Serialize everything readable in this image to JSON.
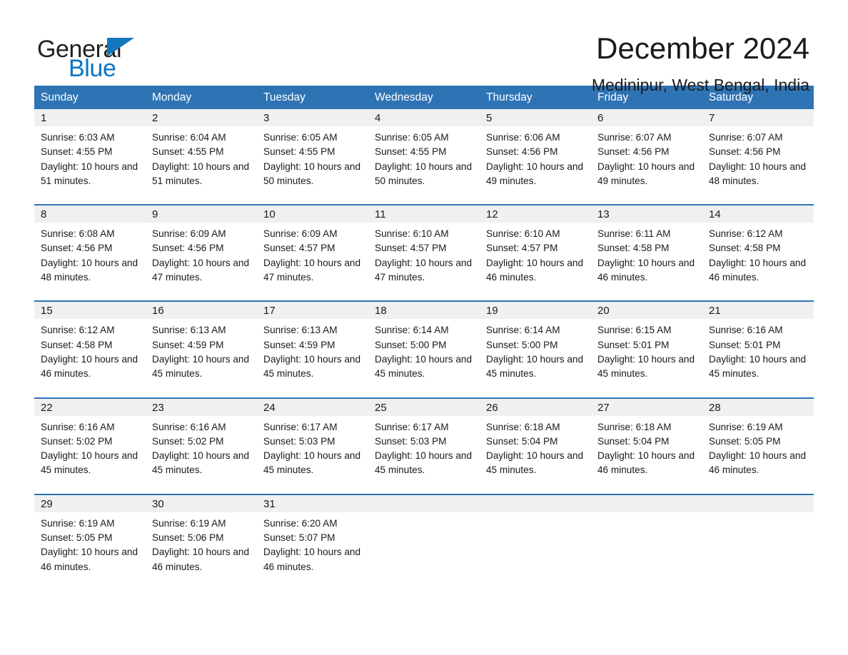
{
  "brand": {
    "word_general": "General",
    "word_blue": "Blue",
    "accent_color": "#2e74b5",
    "triangle_color": "#1277bf"
  },
  "header": {
    "month_title": "December 2024",
    "location": "Medinipur, West Bengal, India"
  },
  "calendar": {
    "weekdays": [
      "Sunday",
      "Monday",
      "Tuesday",
      "Wednesday",
      "Thursday",
      "Friday",
      "Saturday"
    ],
    "weeks": [
      [
        {
          "day": "1",
          "sunrise": "Sunrise: 6:03 AM",
          "sunset": "Sunset: 4:55 PM",
          "daylight": "Daylight: 10 hours and 51 minutes."
        },
        {
          "day": "2",
          "sunrise": "Sunrise: 6:04 AM",
          "sunset": "Sunset: 4:55 PM",
          "daylight": "Daylight: 10 hours and 51 minutes."
        },
        {
          "day": "3",
          "sunrise": "Sunrise: 6:05 AM",
          "sunset": "Sunset: 4:55 PM",
          "daylight": "Daylight: 10 hours and 50 minutes."
        },
        {
          "day": "4",
          "sunrise": "Sunrise: 6:05 AM",
          "sunset": "Sunset: 4:55 PM",
          "daylight": "Daylight: 10 hours and 50 minutes."
        },
        {
          "day": "5",
          "sunrise": "Sunrise: 6:06 AM",
          "sunset": "Sunset: 4:56 PM",
          "daylight": "Daylight: 10 hours and 49 minutes."
        },
        {
          "day": "6",
          "sunrise": "Sunrise: 6:07 AM",
          "sunset": "Sunset: 4:56 PM",
          "daylight": "Daylight: 10 hours and 49 minutes."
        },
        {
          "day": "7",
          "sunrise": "Sunrise: 6:07 AM",
          "sunset": "Sunset: 4:56 PM",
          "daylight": "Daylight: 10 hours and 48 minutes."
        }
      ],
      [
        {
          "day": "8",
          "sunrise": "Sunrise: 6:08 AM",
          "sunset": "Sunset: 4:56 PM",
          "daylight": "Daylight: 10 hours and 48 minutes."
        },
        {
          "day": "9",
          "sunrise": "Sunrise: 6:09 AM",
          "sunset": "Sunset: 4:56 PM",
          "daylight": "Daylight: 10 hours and 47 minutes."
        },
        {
          "day": "10",
          "sunrise": "Sunrise: 6:09 AM",
          "sunset": "Sunset: 4:57 PM",
          "daylight": "Daylight: 10 hours and 47 minutes."
        },
        {
          "day": "11",
          "sunrise": "Sunrise: 6:10 AM",
          "sunset": "Sunset: 4:57 PM",
          "daylight": "Daylight: 10 hours and 47 minutes."
        },
        {
          "day": "12",
          "sunrise": "Sunrise: 6:10 AM",
          "sunset": "Sunset: 4:57 PM",
          "daylight": "Daylight: 10 hours and 46 minutes."
        },
        {
          "day": "13",
          "sunrise": "Sunrise: 6:11 AM",
          "sunset": "Sunset: 4:58 PM",
          "daylight": "Daylight: 10 hours and 46 minutes."
        },
        {
          "day": "14",
          "sunrise": "Sunrise: 6:12 AM",
          "sunset": "Sunset: 4:58 PM",
          "daylight": "Daylight: 10 hours and 46 minutes."
        }
      ],
      [
        {
          "day": "15",
          "sunrise": "Sunrise: 6:12 AM",
          "sunset": "Sunset: 4:58 PM",
          "daylight": "Daylight: 10 hours and 46 minutes."
        },
        {
          "day": "16",
          "sunrise": "Sunrise: 6:13 AM",
          "sunset": "Sunset: 4:59 PM",
          "daylight": "Daylight: 10 hours and 45 minutes."
        },
        {
          "day": "17",
          "sunrise": "Sunrise: 6:13 AM",
          "sunset": "Sunset: 4:59 PM",
          "daylight": "Daylight: 10 hours and 45 minutes."
        },
        {
          "day": "18",
          "sunrise": "Sunrise: 6:14 AM",
          "sunset": "Sunset: 5:00 PM",
          "daylight": "Daylight: 10 hours and 45 minutes."
        },
        {
          "day": "19",
          "sunrise": "Sunrise: 6:14 AM",
          "sunset": "Sunset: 5:00 PM",
          "daylight": "Daylight: 10 hours and 45 minutes."
        },
        {
          "day": "20",
          "sunrise": "Sunrise: 6:15 AM",
          "sunset": "Sunset: 5:01 PM",
          "daylight": "Daylight: 10 hours and 45 minutes."
        },
        {
          "day": "21",
          "sunrise": "Sunrise: 6:16 AM",
          "sunset": "Sunset: 5:01 PM",
          "daylight": "Daylight: 10 hours and 45 minutes."
        }
      ],
      [
        {
          "day": "22",
          "sunrise": "Sunrise: 6:16 AM",
          "sunset": "Sunset: 5:02 PM",
          "daylight": "Daylight: 10 hours and 45 minutes."
        },
        {
          "day": "23",
          "sunrise": "Sunrise: 6:16 AM",
          "sunset": "Sunset: 5:02 PM",
          "daylight": "Daylight: 10 hours and 45 minutes."
        },
        {
          "day": "24",
          "sunrise": "Sunrise: 6:17 AM",
          "sunset": "Sunset: 5:03 PM",
          "daylight": "Daylight: 10 hours and 45 minutes."
        },
        {
          "day": "25",
          "sunrise": "Sunrise: 6:17 AM",
          "sunset": "Sunset: 5:03 PM",
          "daylight": "Daylight: 10 hours and 45 minutes."
        },
        {
          "day": "26",
          "sunrise": "Sunrise: 6:18 AM",
          "sunset": "Sunset: 5:04 PM",
          "daylight": "Daylight: 10 hours and 45 minutes."
        },
        {
          "day": "27",
          "sunrise": "Sunrise: 6:18 AM",
          "sunset": "Sunset: 5:04 PM",
          "daylight": "Daylight: 10 hours and 46 minutes."
        },
        {
          "day": "28",
          "sunrise": "Sunrise: 6:19 AM",
          "sunset": "Sunset: 5:05 PM",
          "daylight": "Daylight: 10 hours and 46 minutes."
        }
      ],
      [
        {
          "day": "29",
          "sunrise": "Sunrise: 6:19 AM",
          "sunset": "Sunset: 5:05 PM",
          "daylight": "Daylight: 10 hours and 46 minutes."
        },
        {
          "day": "30",
          "sunrise": "Sunrise: 6:19 AM",
          "sunset": "Sunset: 5:06 PM",
          "daylight": "Daylight: 10 hours and 46 minutes."
        },
        {
          "day": "31",
          "sunrise": "Sunrise: 6:20 AM",
          "sunset": "Sunset: 5:07 PM",
          "daylight": "Daylight: 10 hours and 46 minutes."
        },
        {
          "day": "",
          "sunrise": "",
          "sunset": "",
          "daylight": ""
        },
        {
          "day": "",
          "sunrise": "",
          "sunset": "",
          "daylight": ""
        },
        {
          "day": "",
          "sunrise": "",
          "sunset": "",
          "daylight": ""
        },
        {
          "day": "",
          "sunrise": "",
          "sunset": "",
          "daylight": ""
        }
      ]
    ]
  }
}
